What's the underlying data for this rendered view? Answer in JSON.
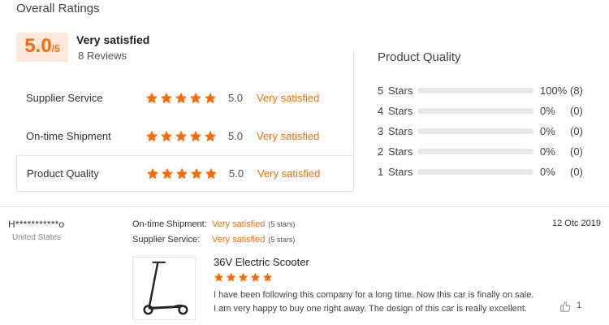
{
  "colors": {
    "accent": "#ff6a00",
    "score_bg": "#fde8dc",
    "track": "#e8e8e8"
  },
  "header": {
    "title": "Overall Ratings"
  },
  "overall": {
    "score": "5.0",
    "out_of": "/5",
    "satisfaction": "Very satisfied",
    "reviews": "8 Reviews"
  },
  "ratings": [
    {
      "label": "Supplier Service",
      "stars": 5,
      "score": "5.0",
      "satisfaction": "Very satisfied"
    },
    {
      "label": "On-time Shipment",
      "stars": 5,
      "score": "5.0",
      "satisfaction": "Very satisfied"
    },
    {
      "label": "Product Quality",
      "stars": 5,
      "score": "5.0",
      "satisfaction": "Very satisfied"
    }
  ],
  "product_quality": {
    "title": "Product Quality",
    "distribution": [
      {
        "stars": "5",
        "label": "Stars",
        "fraction": 1.0,
        "percent": "100%",
        "count": "(8)"
      },
      {
        "stars": "4",
        "label": "Stars",
        "fraction": 0.0,
        "percent": "0%",
        "count": "(0)"
      },
      {
        "stars": "3",
        "label": "Stars",
        "fraction": 0.0,
        "percent": "0%",
        "count": "(0)"
      },
      {
        "stars": "2",
        "label": "Stars",
        "fraction": 0.0,
        "percent": "0%",
        "count": "(0)"
      },
      {
        "stars": "1",
        "label": "Stars",
        "fraction": 0.0,
        "percent": "0%",
        "count": "(0)"
      }
    ]
  },
  "review": {
    "reviewer": "H***********o",
    "country": "United States",
    "date": "12 Otc 2019",
    "meta": [
      {
        "label": "On-time Shipment:",
        "value": "Very satisfied",
        "paren": "(5 stars)"
      },
      {
        "label": "Supplier Service:",
        "value": "Very satisfied",
        "paren": "(5 stars)"
      }
    ],
    "product_name": "36V Electric Scooter",
    "stars": 5,
    "text_lines": [
      "I have been following this company for a long time. Now this car is finally on sale.",
      "I am very happy to buy one right away. The design of this car is really excellent."
    ],
    "likes": "1",
    "thumbnail_icon": "electric-scooter-icon",
    "like_icon": "thumbs-up-icon"
  }
}
